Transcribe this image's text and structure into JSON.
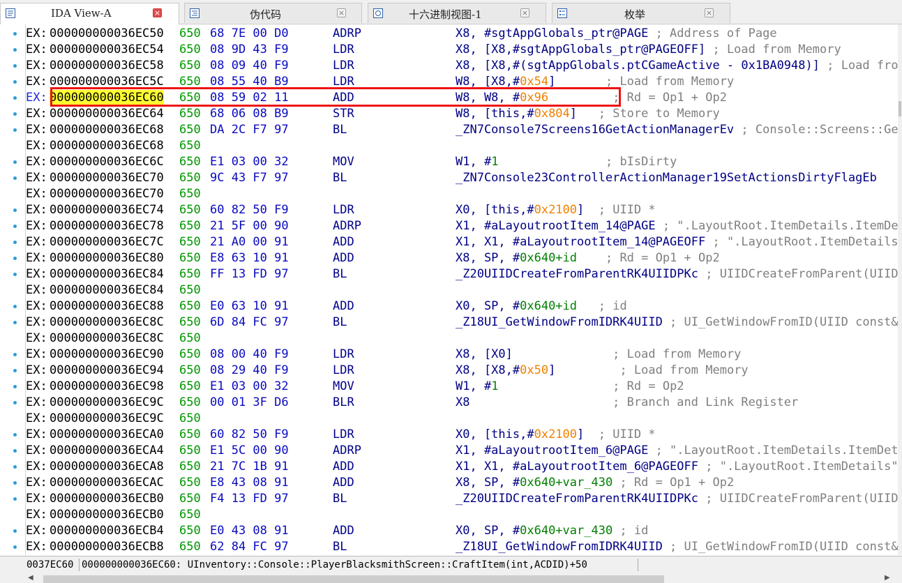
{
  "tabs": [
    {
      "label": "IDA View-A",
      "icon": "disassembly-view-icon",
      "active": true
    },
    {
      "label": "伪代码",
      "icon": "pseudocode-icon",
      "active": false
    },
    {
      "label": "十六进制视图-1",
      "icon": "hex-view-icon",
      "active": false
    },
    {
      "label": "枚举",
      "icon": "enums-icon",
      "active": false
    }
  ],
  "colors": {
    "selection_box": "#ee1111",
    "highlight": "#ffff30",
    "gutter_dot": "#2f9adb"
  },
  "lines": [
    {
      "dot": true,
      "addr": "000000000036EC50",
      "bytes": "68 7E 00 D0",
      "mn": "ADRP",
      "parts": [
        [
          "o",
          "X8, #sgtAppGlobals_ptr@PAGE "
        ],
        [
          "c",
          "; Address of Page"
        ]
      ]
    },
    {
      "dot": true,
      "addr": "000000000036EC54",
      "bytes": "08 9D 43 F9",
      "mn": "LDR",
      "parts": [
        [
          "o",
          "X8, [X8,#sgtAppGlobals_ptr@PAGEOFF] "
        ],
        [
          "c",
          "; Load from Memory"
        ]
      ]
    },
    {
      "dot": true,
      "addr": "000000000036EC58",
      "bytes": "08 09 40 F9",
      "mn": "LDR",
      "parts": [
        [
          "o",
          "X8, [X8,#(sgtAppGlobals.ptCGameActive - 0x1BA0948)] "
        ],
        [
          "c",
          "; Load from Memory"
        ]
      ]
    },
    {
      "dot": true,
      "addr": "000000000036EC5C",
      "bytes": "08 55 40 B9",
      "mn": "LDR",
      "parts": [
        [
          "o",
          "W8, [X8,#"
        ],
        [
          "n",
          "0x54"
        ],
        [
          "o",
          "]       "
        ],
        [
          "c",
          "; Load from Memory"
        ]
      ]
    },
    {
      "dot": true,
      "addr": "000000000036EC60",
      "bytes": "08 59 02 11",
      "mn": "ADD",
      "selected": true,
      "parts": [
        [
          "o",
          "W8, W8, #"
        ],
        [
          "n",
          "0x96"
        ],
        [
          "o",
          "         "
        ],
        [
          "c",
          "; Rd = Op1 + Op2"
        ]
      ]
    },
    {
      "dot": true,
      "addr": "000000000036EC64",
      "bytes": "68 06 08 B9",
      "mn": "STR",
      "parts": [
        [
          "o",
          "W8, [this,#"
        ],
        [
          "n",
          "0x804"
        ],
        [
          "o",
          "]   "
        ],
        [
          "c",
          "; Store to Memory"
        ]
      ]
    },
    {
      "dot": true,
      "addr": "000000000036EC68",
      "bytes": "DA 2C F7 97",
      "mn": "BL",
      "parts": [
        [
          "o",
          "_ZN7Console7Screens16GetActionManagerEv "
        ],
        [
          "c",
          "; Console::Screens::GetActionManager(void)"
        ]
      ]
    },
    {
      "dot": false,
      "addr": "000000000036EC68",
      "bytes": "",
      "mn": "",
      "parts": []
    },
    {
      "dot": true,
      "addr": "000000000036EC6C",
      "bytes": "E1 03 00 32",
      "mn": "MOV",
      "parts": [
        [
          "o",
          "W1, #"
        ],
        [
          "g",
          "1"
        ],
        [
          "o",
          "               "
        ],
        [
          "c",
          "; bIsDirty"
        ]
      ]
    },
    {
      "dot": true,
      "addr": "000000000036EC70",
      "bytes": "9C 43 F7 97",
      "mn": "BL",
      "parts": [
        [
          "o",
          "_ZN7Console23ControllerActionManager19SetActionsDirtyFlagEb"
        ]
      ]
    },
    {
      "dot": false,
      "addr": "000000000036EC70",
      "bytes": "",
      "mn": "",
      "parts": []
    },
    {
      "dot": true,
      "addr": "000000000036EC74",
      "bytes": "60 82 50 F9",
      "mn": "LDR",
      "parts": [
        [
          "o",
          "X0, [this,#"
        ],
        [
          "n",
          "0x2100"
        ],
        [
          "o",
          "]  "
        ],
        [
          "c",
          "; UIID *"
        ]
      ]
    },
    {
      "dot": true,
      "addr": "000000000036EC78",
      "bytes": "21 5F 00 90",
      "mn": "ADRP",
      "parts": [
        [
          "o",
          "X1, #aLayoutrootItem_14@PAGE "
        ],
        [
          "c",
          "; \".LayoutRoot.ItemDetails.ItemDetails\""
        ]
      ]
    },
    {
      "dot": true,
      "addr": "000000000036EC7C",
      "bytes": "21 A0 00 91",
      "mn": "ADD",
      "parts": [
        [
          "o",
          "X1, X1, #aLayoutrootItem_14@PAGEOFF "
        ],
        [
          "c",
          "; \".LayoutRoot.ItemDetails\""
        ]
      ]
    },
    {
      "dot": true,
      "addr": "000000000036EC80",
      "bytes": "E8 63 10 91",
      "mn": "ADD",
      "parts": [
        [
          "o",
          "X8, SP, #"
        ],
        [
          "g",
          "0x640+id"
        ],
        [
          "o",
          "    "
        ],
        [
          "c",
          "; Rd = Op1 + Op2"
        ]
      ]
    },
    {
      "dot": true,
      "addr": "000000000036EC84",
      "bytes": "FF 13 FD 97",
      "mn": "BL",
      "parts": [
        [
          "o",
          "_Z20UIIDCreateFromParentRK4UIIDPKc "
        ],
        [
          "c",
          "; UIIDCreateFromParent(UIID const&,char const*)"
        ]
      ]
    },
    {
      "dot": false,
      "addr": "000000000036EC84",
      "bytes": "",
      "mn": "",
      "parts": []
    },
    {
      "dot": true,
      "addr": "000000000036EC88",
      "bytes": "E0 63 10 91",
      "mn": "ADD",
      "parts": [
        [
          "o",
          "X0, SP, #"
        ],
        [
          "g",
          "0x640+id"
        ],
        [
          "o",
          "   "
        ],
        [
          "c",
          "; id"
        ]
      ]
    },
    {
      "dot": true,
      "addr": "000000000036EC8C",
      "bytes": "6D 84 FC 97",
      "mn": "BL",
      "parts": [
        [
          "o",
          "_Z18UI_GetWindowFromIDRK4UIID "
        ],
        [
          "c",
          "; UI_GetWindowFromID(UIID const&)"
        ]
      ]
    },
    {
      "dot": false,
      "addr": "000000000036EC8C",
      "bytes": "",
      "mn": "",
      "parts": []
    },
    {
      "dot": true,
      "addr": "000000000036EC90",
      "bytes": "08 00 40 F9",
      "mn": "LDR",
      "parts": [
        [
          "o",
          "X8, [X0]              "
        ],
        [
          "c",
          "; Load from Memory"
        ]
      ]
    },
    {
      "dot": true,
      "addr": "000000000036EC94",
      "bytes": "08 29 40 F9",
      "mn": "LDR",
      "parts": [
        [
          "o",
          "X8, [X8,#"
        ],
        [
          "n",
          "0x50"
        ],
        [
          "o",
          "]         "
        ],
        [
          "c",
          "; Load from Memory"
        ]
      ]
    },
    {
      "dot": true,
      "addr": "000000000036EC98",
      "bytes": "E1 03 00 32",
      "mn": "MOV",
      "parts": [
        [
          "o",
          "W1, #"
        ],
        [
          "g",
          "1"
        ],
        [
          "o",
          "                "
        ],
        [
          "c",
          "; Rd = Op2"
        ]
      ]
    },
    {
      "dot": true,
      "addr": "000000000036EC9C",
      "bytes": "00 01 3F D6",
      "mn": "BLR",
      "parts": [
        [
          "o",
          "X8                    "
        ],
        [
          "c",
          "; Branch and Link Register"
        ]
      ]
    },
    {
      "dot": false,
      "addr": "000000000036EC9C",
      "bytes": "",
      "mn": "",
      "parts": []
    },
    {
      "dot": true,
      "addr": "000000000036ECA0",
      "bytes": "60 82 50 F9",
      "mn": "LDR",
      "parts": [
        [
          "o",
          "X0, [this,#"
        ],
        [
          "n",
          "0x2100"
        ],
        [
          "o",
          "]  "
        ],
        [
          "c",
          "; UIID *"
        ]
      ]
    },
    {
      "dot": true,
      "addr": "000000000036ECA4",
      "bytes": "E1 5C 00 90",
      "mn": "ADRP",
      "parts": [
        [
          "o",
          "X1, #aLayoutrootItem_6@PAGE "
        ],
        [
          "c",
          "; \".LayoutRoot.ItemDetails.ItemDetails\""
        ]
      ]
    },
    {
      "dot": true,
      "addr": "000000000036ECA8",
      "bytes": "21 7C 1B 91",
      "mn": "ADD",
      "parts": [
        [
          "o",
          "X1, X1, #aLayoutrootItem_6@PAGEOFF "
        ],
        [
          "c",
          "; \".LayoutRoot.ItemDetails\""
        ]
      ]
    },
    {
      "dot": true,
      "addr": "000000000036ECAC",
      "bytes": "E8 43 08 91",
      "mn": "ADD",
      "parts": [
        [
          "o",
          "X8, SP, #"
        ],
        [
          "g",
          "0x640+var_430"
        ],
        [
          "o",
          " "
        ],
        [
          "c",
          "; Rd = Op1 + Op2"
        ]
      ]
    },
    {
      "dot": true,
      "addr": "000000000036ECB0",
      "bytes": "F4 13 FD 97",
      "mn": "BL",
      "parts": [
        [
          "o",
          "_Z20UIIDCreateFromParentRK4UIIDPKc "
        ],
        [
          "c",
          "; UIIDCreateFromParent(UIID const&,char const*)"
        ]
      ]
    },
    {
      "dot": false,
      "addr": "000000000036ECB0",
      "bytes": "",
      "mn": "",
      "parts": []
    },
    {
      "dot": true,
      "addr": "000000000036ECB4",
      "bytes": "E0 43 08 91",
      "mn": "ADD",
      "parts": [
        [
          "o",
          "X0, SP, #"
        ],
        [
          "g",
          "0x640+var_430"
        ],
        [
          "o",
          " "
        ],
        [
          "c",
          "; id"
        ]
      ]
    },
    {
      "dot": true,
      "addr": "000000000036ECB8",
      "bytes": "62 84 FC 97",
      "mn": "BL",
      "parts": [
        [
          "o",
          "_Z18UI_GetWindowFromIDRK4UIID "
        ],
        [
          "c",
          "; UI_GetWindowFromID(UIID const&)"
        ]
      ]
    }
  ],
  "segment": "EX:",
  "tag650": "650",
  "status": {
    "offset": "0037EC60",
    "location": "000000000036EC60: UInventory::Console::PlayerBlacksmithScreen::CraftItem(int,ACDID)+50"
  }
}
